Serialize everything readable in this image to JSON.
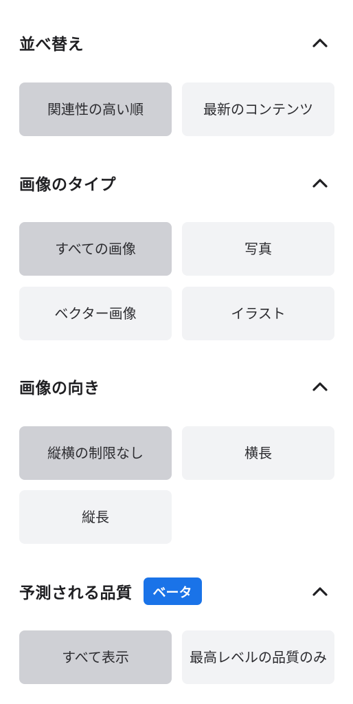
{
  "sort": {
    "title": "並べ替え",
    "options": [
      "関連性の高い順",
      "最新のコンテンツ"
    ]
  },
  "image_type": {
    "title": "画像のタイプ",
    "options": [
      "すべての画像",
      "写真",
      "ベクター画像",
      "イラスト"
    ]
  },
  "orientation": {
    "title": "画像の向き",
    "options": [
      "縦横の制限なし",
      "横長",
      "縦長"
    ]
  },
  "quality": {
    "title": "予測される品質",
    "badge": "ベータ",
    "options": [
      "すべて表示",
      "最高レベルの品質のみ"
    ]
  },
  "colors": {
    "selected_bg": "#cfd0d5",
    "option_bg": "#f2f3f5",
    "badge_bg": "#1a73e8"
  },
  "icons": {
    "collapse": "chevron-up-icon"
  }
}
